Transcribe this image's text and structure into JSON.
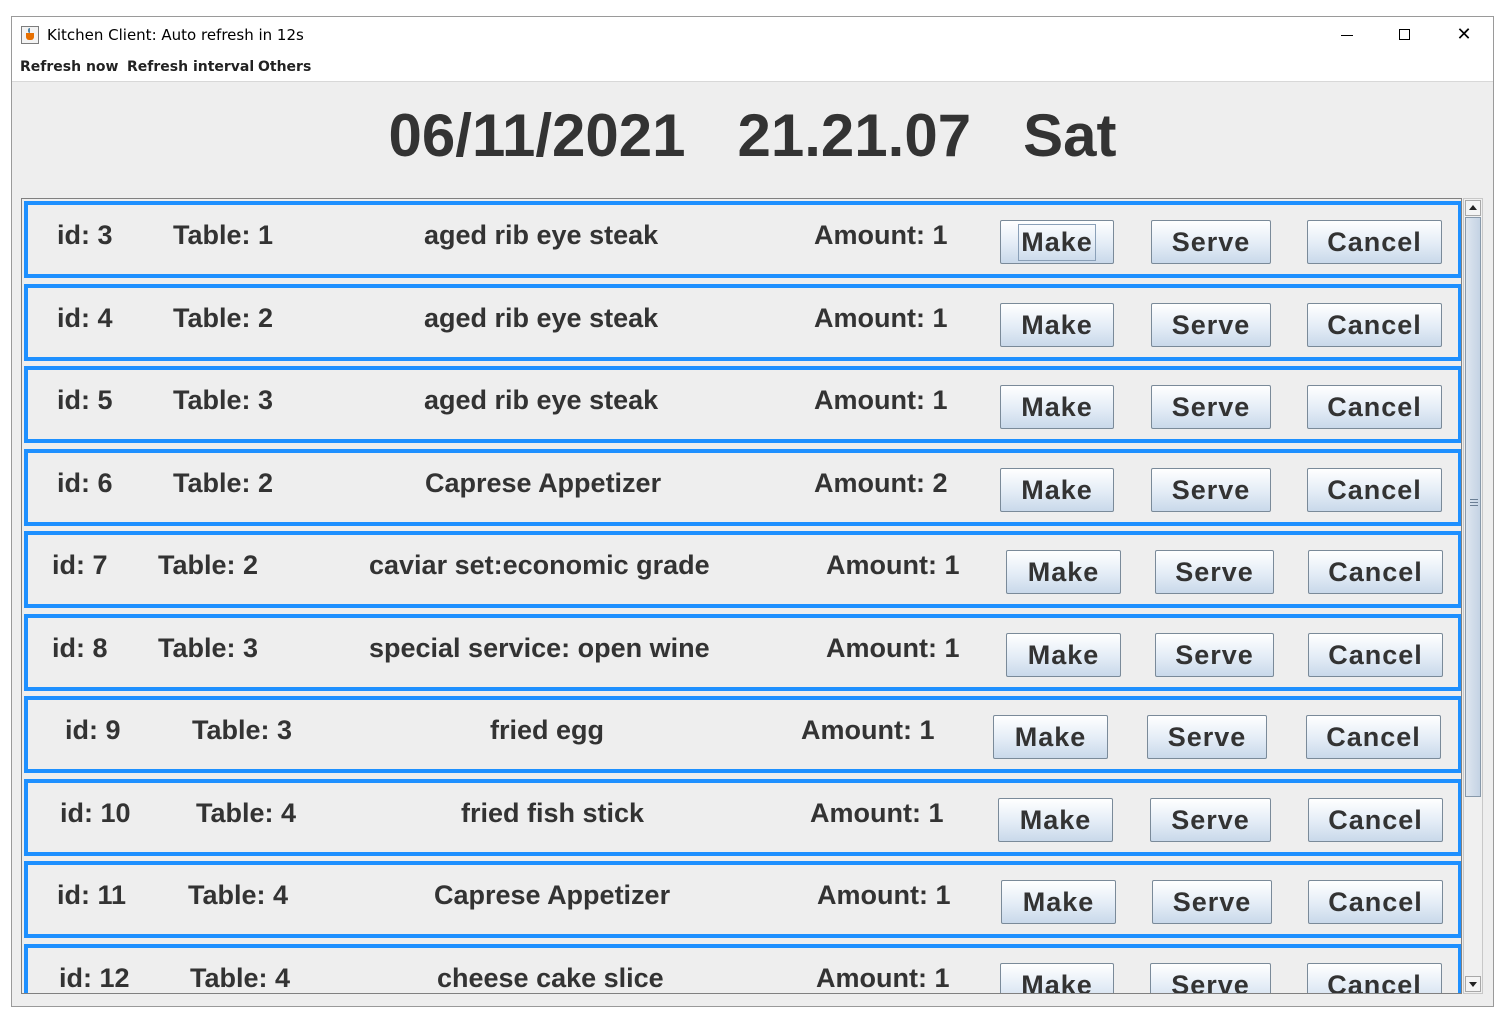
{
  "window": {
    "title": "Kitchen Client: Auto refresh in 12s"
  },
  "menu": [
    "Refresh now",
    "Refresh interval",
    "Others"
  ],
  "clock": {
    "date": "06/11/2021",
    "time": "21.21.07",
    "day": "Sat"
  },
  "buttons": {
    "make": "Make",
    "serve": "Serve",
    "cancel": "Cancel"
  },
  "orders": [
    {
      "id": "id: 3",
      "table": "Table: 1",
      "item": "aged rib eye steak",
      "amount": "Amount: 1"
    },
    {
      "id": "id: 4",
      "table": "Table: 2",
      "item": "aged rib eye steak",
      "amount": "Amount: 1"
    },
    {
      "id": "id: 5",
      "table": "Table: 3",
      "item": "aged rib eye steak",
      "amount": "Amount: 1"
    },
    {
      "id": "id: 6",
      "table": "Table: 2",
      "item": "Caprese Appetizer",
      "amount": "Amount: 2"
    },
    {
      "id": "id: 7",
      "table": "Table: 2",
      "item": "caviar set:economic grade",
      "amount": "Amount: 1"
    },
    {
      "id": "id: 8",
      "table": "Table: 3",
      "item": "special service: open wine",
      "amount": "Amount: 1"
    },
    {
      "id": "id: 9",
      "table": "Table: 3",
      "item": "fried egg",
      "amount": "Amount: 1"
    },
    {
      "id": "id: 10",
      "table": "Table: 4",
      "item": "fried fish stick",
      "amount": "Amount: 1"
    },
    {
      "id": "id: 11",
      "table": "Table: 4",
      "item": "Caprese Appetizer",
      "amount": "Amount: 1"
    },
    {
      "id": "id: 12",
      "table": "Table: 4",
      "item": "cheese cake slice",
      "amount": "Amount: 1"
    }
  ]
}
